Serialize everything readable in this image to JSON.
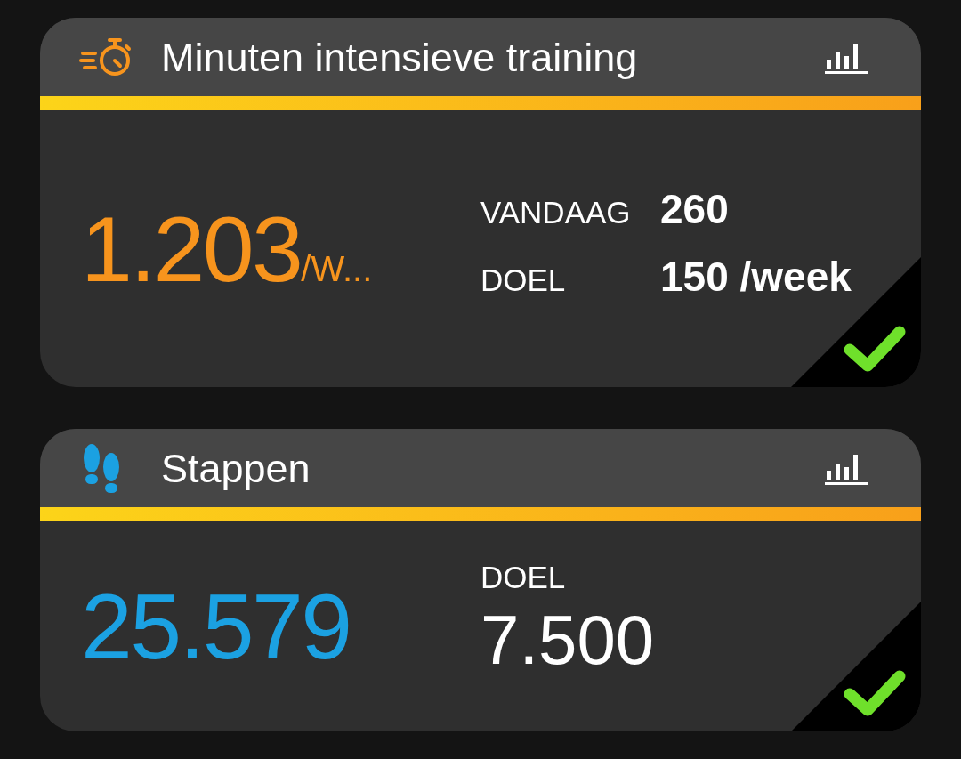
{
  "cards": [
    {
      "title": "Minuten intensieve training",
      "kind": "inline",
      "value": "1.203",
      "unit": "/W...",
      "color": "#f7941d",
      "goal_met": true,
      "details": [
        {
          "label": "VANDAAG",
          "value": "260"
        },
        {
          "label": "DOEL",
          "value": "150 /week"
        }
      ]
    },
    {
      "title": "Stappen",
      "kind": "stacked",
      "value": "25.579",
      "color": "#1ba1e2",
      "goal_met": true,
      "details": [
        {
          "label": "DOEL",
          "value": "7.500"
        }
      ]
    }
  ]
}
